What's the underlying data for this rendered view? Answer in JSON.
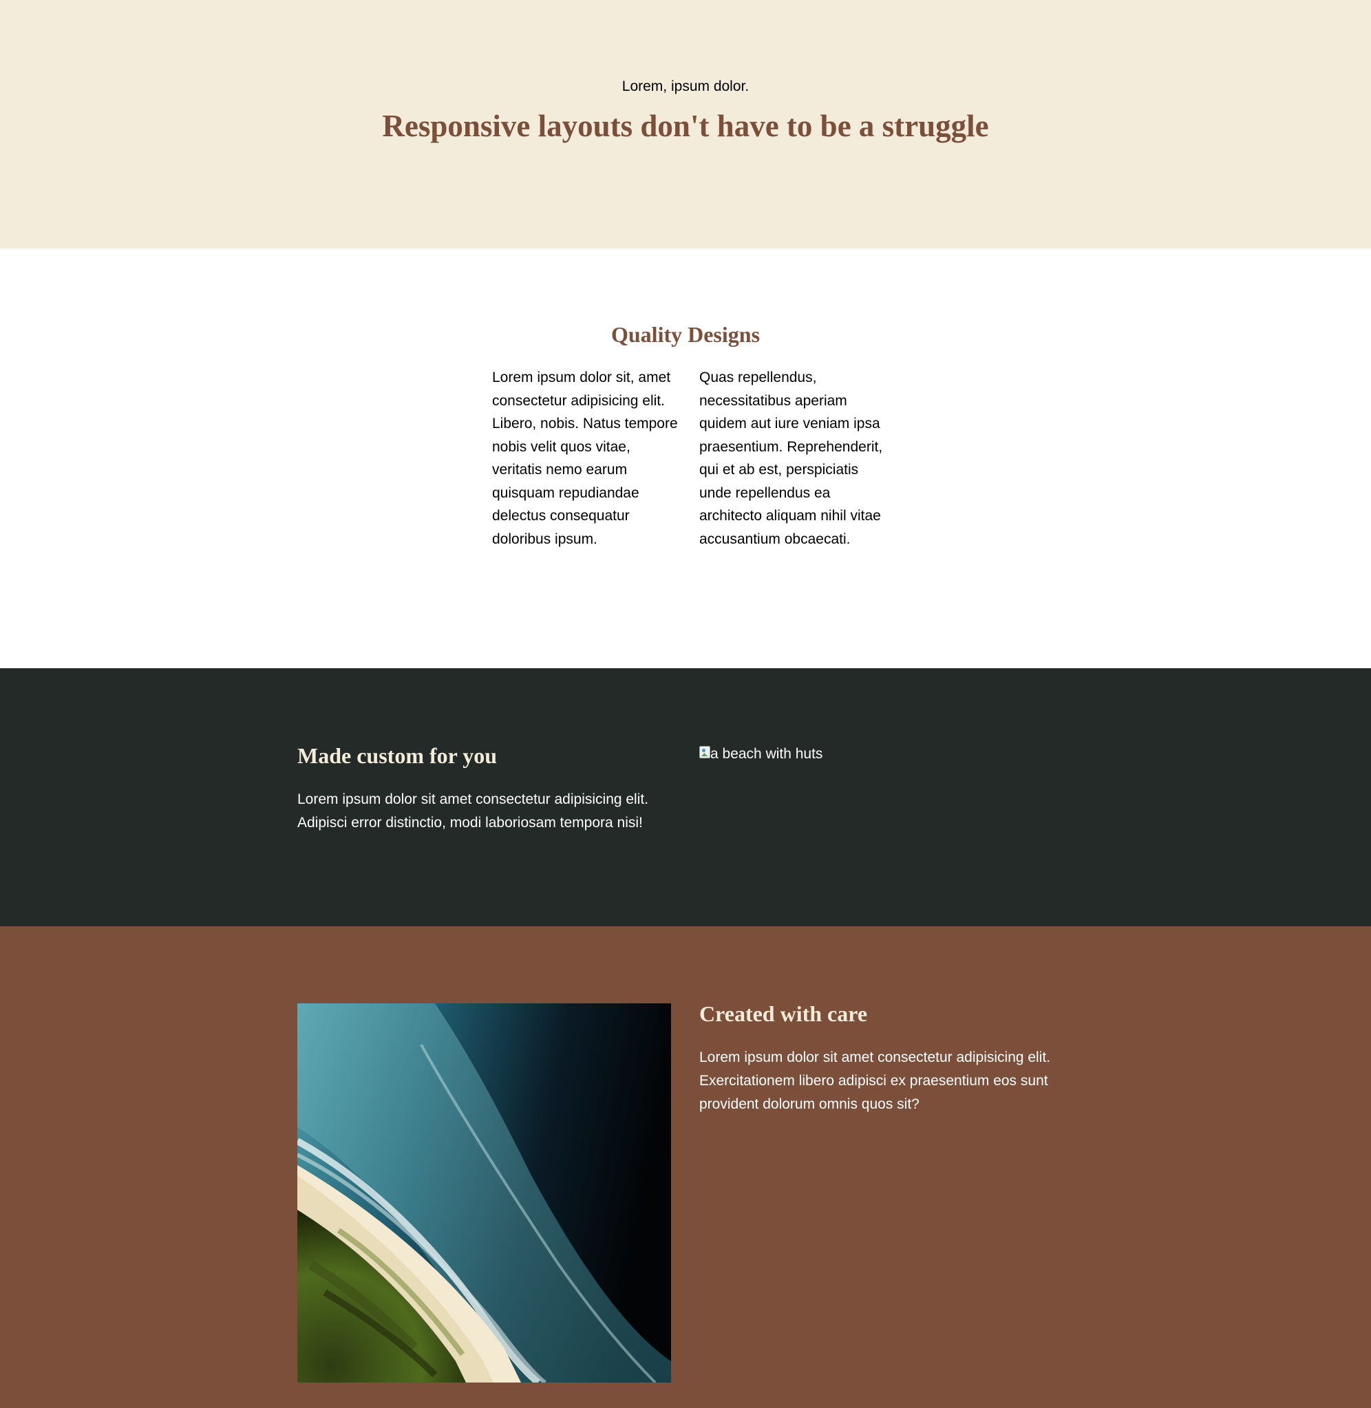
{
  "hero": {
    "eyebrow": "Lorem, ipsum dolor.",
    "title": "Responsive layouts don't have to be a struggle"
  },
  "quality": {
    "title": "Quality Designs",
    "col1": "Lorem ipsum dolor sit, amet consectetur adipisicing elit. Libero, nobis. Natus tempore nobis velit quos vitae, veritatis nemo earum quisquam repudiandae delectus consequatur doloribus ipsum.",
    "col2": "Quas repellendus, necessitatibus aperiam quidem aut iure veniam ipsa praesentium. Reprehenderit, qui et ab est, perspiciatis unde repellendus ea architecto aliquam nihil vitae accusantium obcaecati."
  },
  "custom": {
    "title": "Made custom for you",
    "text": "Lorem ipsum dolor sit amet consectetur adipisicing elit. Adipisci error distinctio, modi laboriosam tempora nisi!",
    "image_alt": "a beach with huts"
  },
  "care": {
    "title": "Created with care",
    "text": "Lorem ipsum dolor sit amet consectetur adipisicing elit. Exercitationem libero adipisci ex praesentium eos sunt provident dolorum omnis quos sit?"
  },
  "colors": {
    "hero_bg": "#f3ecda",
    "accent_brown": "#7b4f3a",
    "dark_bg": "#232a28",
    "heading_cream": "#f3ecda"
  }
}
